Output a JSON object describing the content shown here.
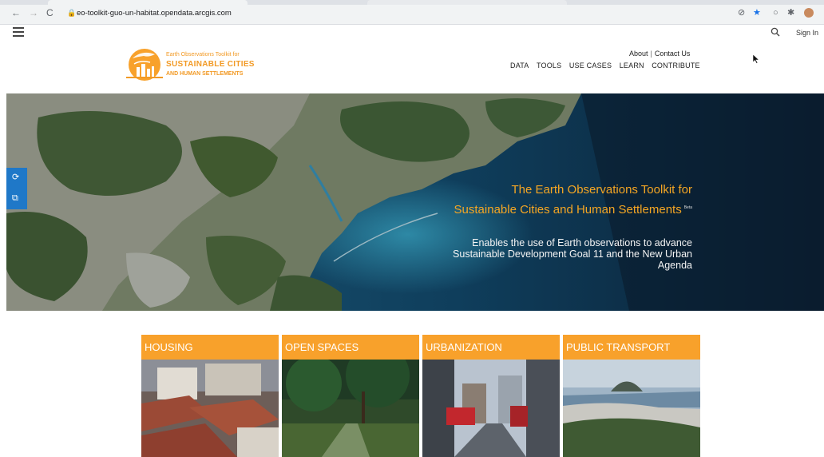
{
  "browser": {
    "url": "eo-toolkit-guo-un-habitat.opendata.arcgis.com",
    "back_glyph": "←",
    "forward_glyph": "→",
    "reload_glyph": "C",
    "lock_glyph": "🔒",
    "extension_glyphs": [
      "⊘",
      "★",
      "○",
      "✱"
    ],
    "accent": "#1a73e8"
  },
  "header": {
    "sign_in": "Sign In",
    "utility_links": [
      "About",
      "Contact Us"
    ],
    "utility_separator": "|",
    "nav": [
      "DATA",
      "TOOLS",
      "USE CASES",
      "LEARN",
      "CONTRIBUTE"
    ]
  },
  "logo": {
    "line1": "Earth Observations Toolkit for",
    "line2": "SUSTAINABLE CITIES",
    "line3": "AND HUMAN SETTLEMENTS",
    "color": "#f29a25"
  },
  "hero": {
    "title": "The Earth Observations Toolkit for Sustainable Cities and Human Settlements",
    "badge": "Beta",
    "subtitle": "Enables the use of Earth observations to advance Sustainable Development Goal 11 and the New Urban Agenda",
    "title_color": "#f5a623"
  },
  "side_tools": [
    "⟳",
    "⧉"
  ],
  "cards": [
    {
      "label": "HOUSING"
    },
    {
      "label": "OPEN SPACES"
    },
    {
      "label": "URBANIZATION"
    },
    {
      "label": "PUBLIC TRANSPORT"
    }
  ],
  "card_color": "#f8a12b"
}
